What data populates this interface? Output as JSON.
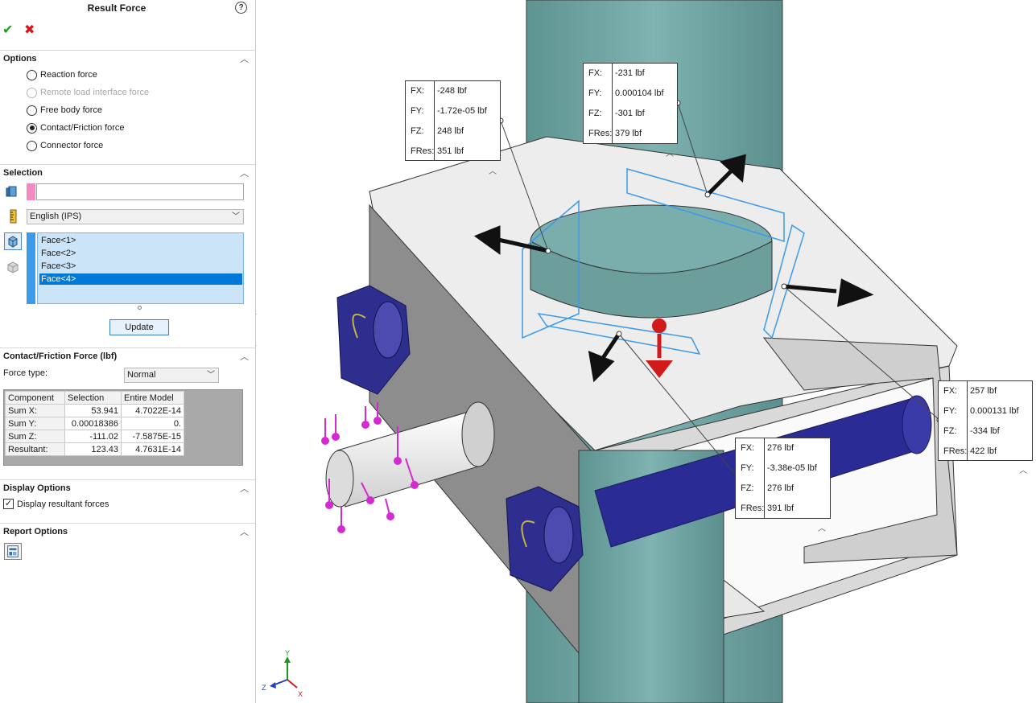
{
  "panel": {
    "title": "Result Force",
    "help": "?",
    "ok": "✔",
    "cancel": "✖",
    "options": {
      "header": "Options",
      "radios": [
        {
          "label": "Reaction force",
          "checked": false,
          "disabled": false
        },
        {
          "label": "Remote load interface force",
          "checked": false,
          "disabled": true
        },
        {
          "label": "Free body force",
          "checked": false,
          "disabled": false
        },
        {
          "label": "Contact/Friction force",
          "checked": true,
          "disabled": false
        },
        {
          "label": "Connector force",
          "checked": false,
          "disabled": false
        }
      ]
    },
    "selection": {
      "header": "Selection",
      "input_value": "",
      "units": "English (IPS)",
      "faces": [
        "Face<1>",
        "Face<2>",
        "Face<3>",
        "Face<4>"
      ],
      "selected_face": "Face<4>",
      "update": "Update"
    },
    "contact": {
      "header": "Contact/Friction Force (lbf)",
      "force_type_label": "Force type:",
      "force_type": "Normal",
      "table": {
        "headers": [
          "Component",
          "Selection",
          "Entire Model"
        ],
        "rows": [
          [
            "Sum X:",
            "53.941",
            "4.7022E-14"
          ],
          [
            "Sum Y:",
            "0.00018386",
            "0."
          ],
          [
            "Sum Z:",
            "-111.02",
            "-7.5875E-15"
          ],
          [
            "Resultant:",
            "123.43",
            "4.7631E-14"
          ]
        ]
      }
    },
    "display": {
      "header": "Display Options",
      "checkbox_label": "Display resultant forces",
      "checked": true
    },
    "report": {
      "header": "Report Options"
    }
  },
  "callouts": [
    {
      "id": "c1",
      "rows": [
        [
          "FX:",
          "-248 lbf"
        ],
        [
          "FY:",
          "-1.72e-05 lbf"
        ],
        [
          "FZ:",
          "248 lbf"
        ],
        [
          "FRes:",
          "351 lbf"
        ]
      ]
    },
    {
      "id": "c2",
      "rows": [
        [
          "FX:",
          "-231 lbf"
        ],
        [
          "FY:",
          "0.000104 lbf"
        ],
        [
          "FZ:",
          "-301 lbf"
        ],
        [
          "FRes:",
          "379 lbf"
        ]
      ]
    },
    {
      "id": "c3",
      "rows": [
        [
          "FX:",
          "257 lbf"
        ],
        [
          "FY:",
          "0.000131 lbf"
        ],
        [
          "FZ:",
          "-334 lbf"
        ],
        [
          "FRes:",
          "422 lbf"
        ]
      ]
    },
    {
      "id": "c4",
      "rows": [
        [
          "FX:",
          "276 lbf"
        ],
        [
          "FY:",
          "-3.38e-05 lbf"
        ],
        [
          "FZ:",
          "276 lbf"
        ],
        [
          "FRes:",
          "391 lbf"
        ]
      ]
    }
  ],
  "triad": {
    "y": "Y",
    "z": "Z",
    "x": "X"
  },
  "colors": {
    "shaft": "#6fa6a4",
    "bracket": "#e8e8e8",
    "bolt": "#2e2e8f",
    "pin": "#f2f2f2",
    "load_arrow": "#d42ad0",
    "selection_blue": "#3c9ae8",
    "pink_swatch": "#f48ac2"
  }
}
